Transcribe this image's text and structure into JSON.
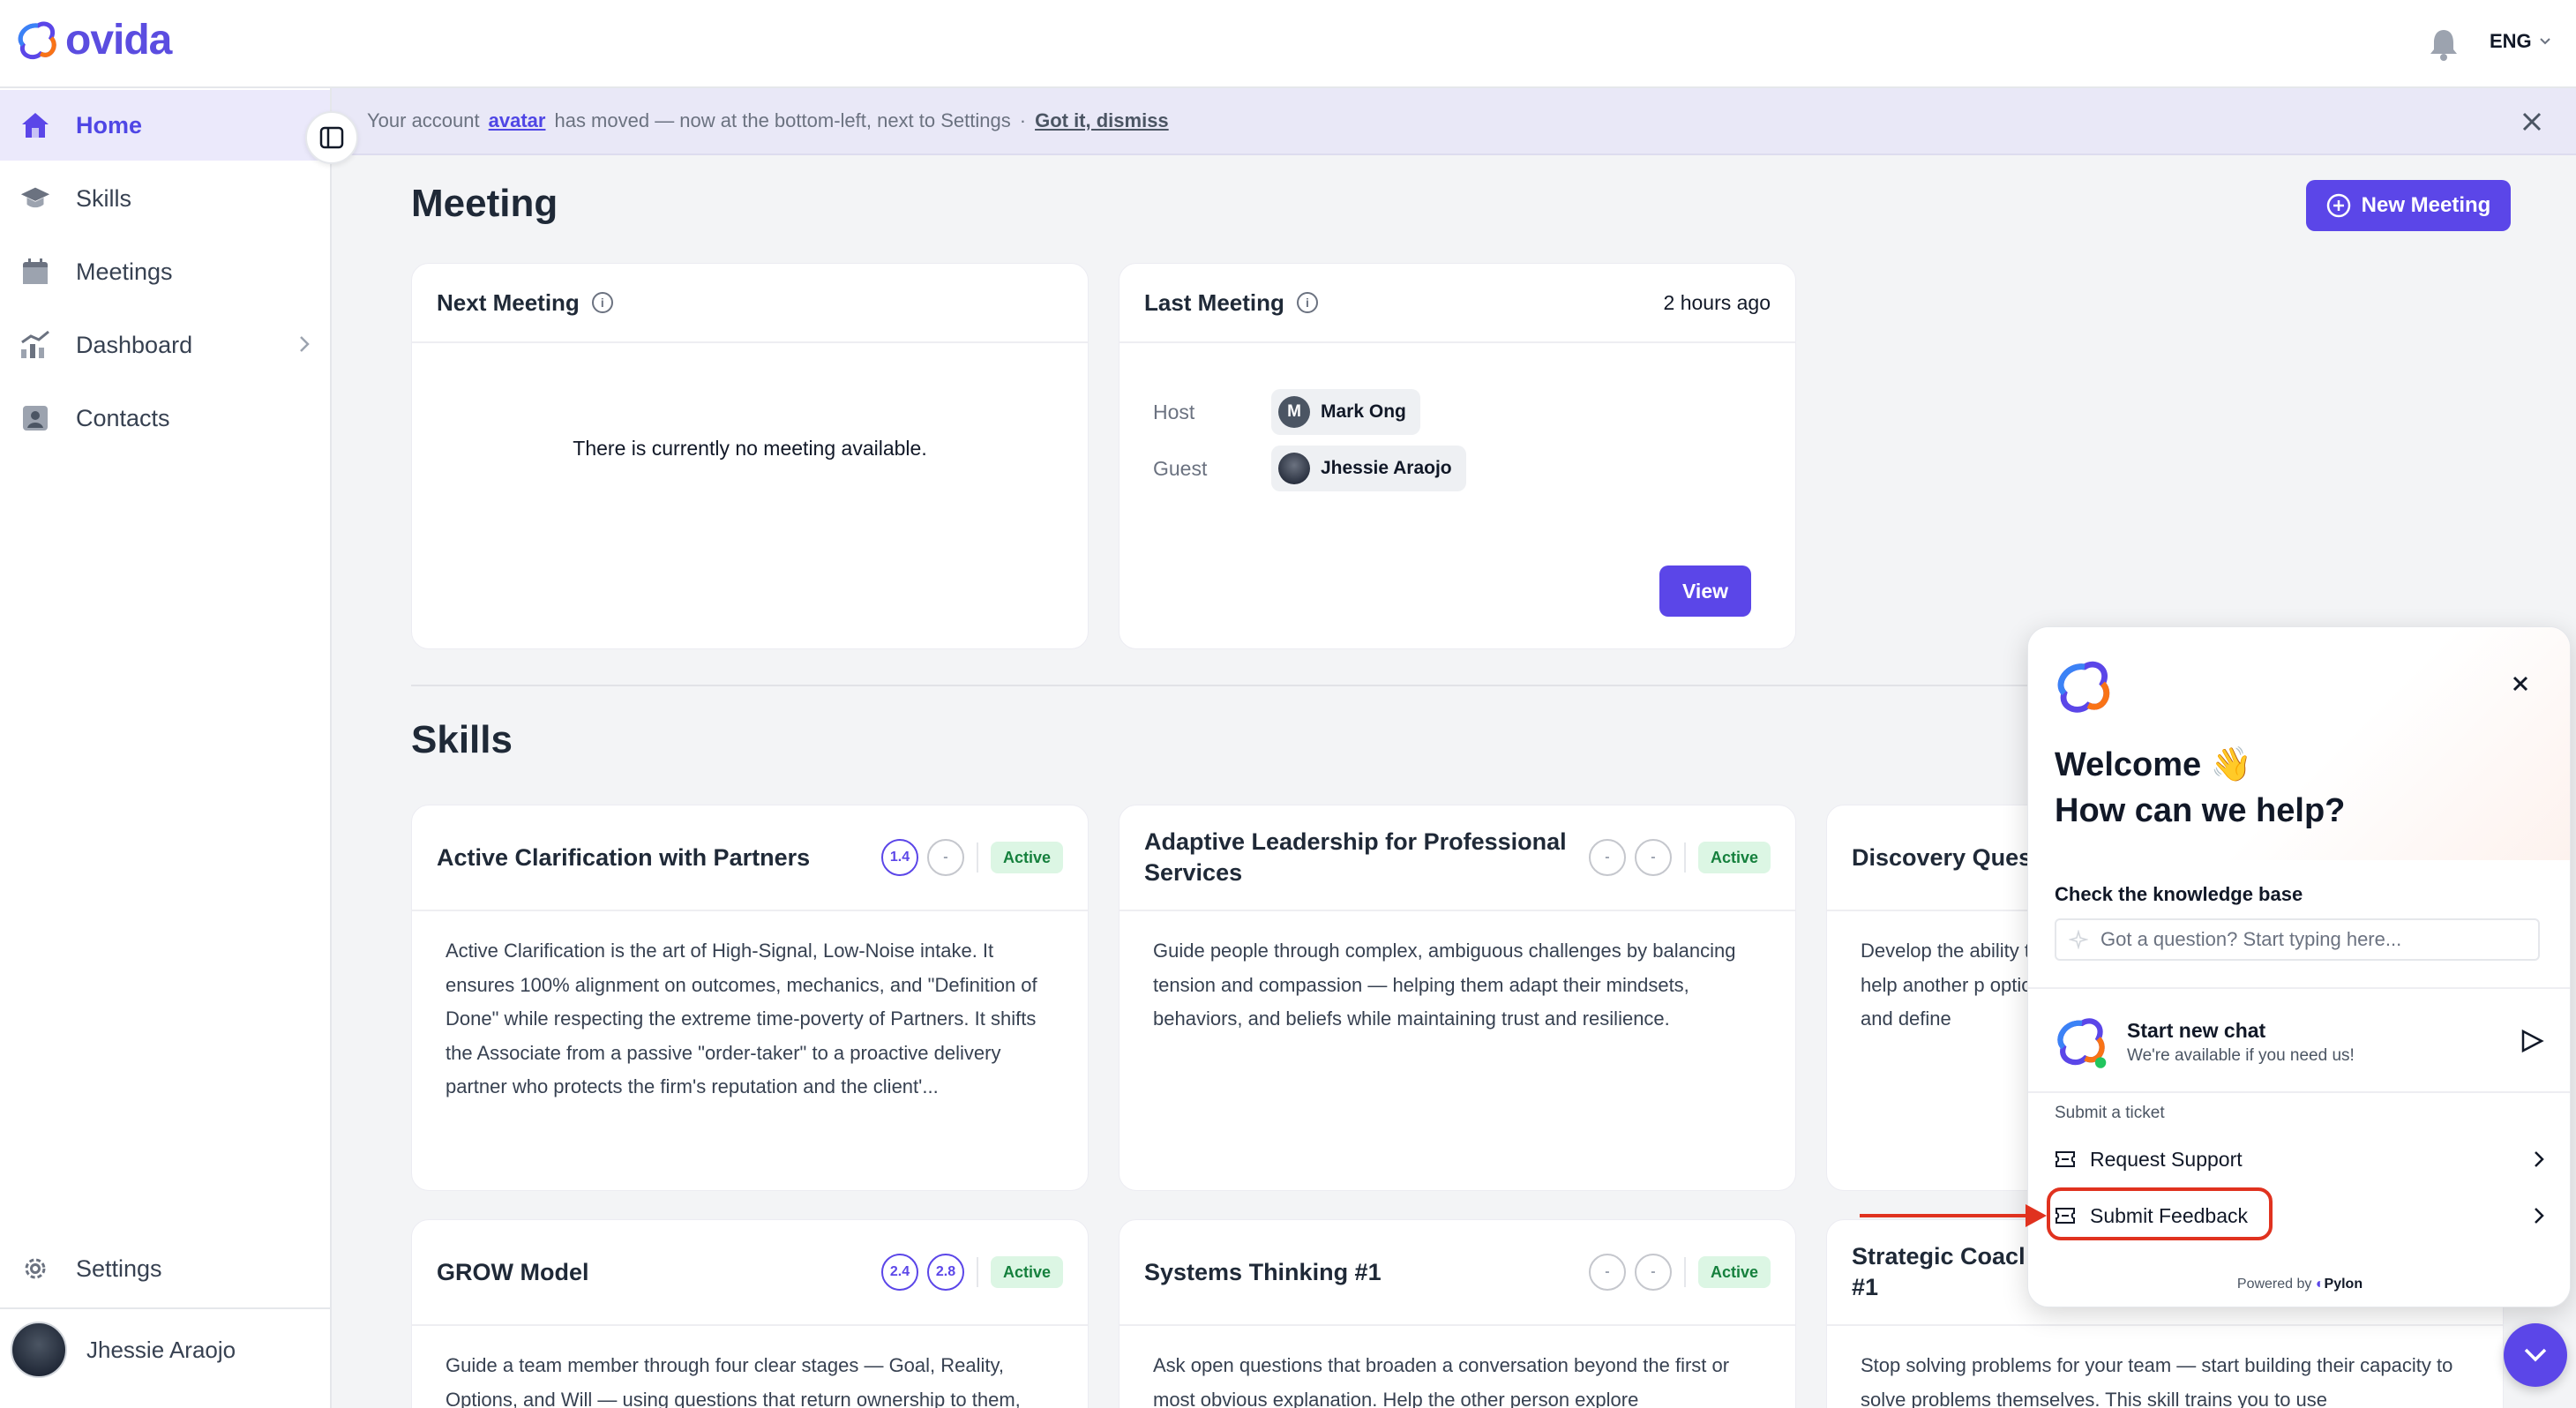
{
  "brand": {
    "name": "ovida",
    "accent": "#5b46e8"
  },
  "header": {
    "language": "ENG"
  },
  "sidebar": {
    "items": [
      {
        "label": "Home",
        "icon": "home-icon",
        "active": true
      },
      {
        "label": "Skills",
        "icon": "graduation-cap-icon"
      },
      {
        "label": "Meetings",
        "icon": "calendar-icon"
      },
      {
        "label": "Dashboard",
        "icon": "chart-icon",
        "has_submenu": true
      },
      {
        "label": "Contacts",
        "icon": "contact-card-icon"
      }
    ],
    "settings_label": "Settings",
    "user_name": "Jhessie Araojo"
  },
  "banner": {
    "prefix": "Your account",
    "link": "avatar",
    "message": "has moved — now at the bottom-left, next to Settings",
    "separator": "·",
    "dismiss": "Got it, dismiss"
  },
  "meeting": {
    "title": "Meeting",
    "new_button": "New Meeting",
    "next": {
      "title": "Next Meeting",
      "empty": "There is currently no meeting available."
    },
    "last": {
      "title": "Last Meeting",
      "time": "2 hours ago",
      "host_label": "Host",
      "host_name": "Mark Ong",
      "host_initial": "M",
      "guest_label": "Guest",
      "guest_name": "Jhessie Araojo",
      "view_button": "View"
    }
  },
  "skills": {
    "title": "Skills",
    "cards": [
      {
        "name": "Active Clarification with Partners",
        "score1": "1.4",
        "score2": "-",
        "status": "Active",
        "description": "Active Clarification is the art of High-Signal, Low-Noise intake. It ensures 100% alignment on outcomes, mechanics, and \"Definition of Done\" while respecting the extreme time-poverty of Partners. It shifts the Associate from a passive \"order-taker\" to a proactive delivery partner who protects the firm's reputation and the client'..."
      },
      {
        "name": "Adaptive Leadership for Professional Services",
        "score1": "-",
        "score2": "-",
        "status": "Active",
        "description": "Guide people through complex, ambiguous challenges by balancing tension and compassion — helping them adapt their mindsets, behaviors, and beliefs while maintaining trust and resilience."
      },
      {
        "name": "Discovery Ques",
        "description": "Develop the ability that help another p options, and define"
      },
      {
        "name": "GROW Model",
        "score1": "2.4",
        "score2": "2.8",
        "status": "Active",
        "description": "Guide a team member through four clear stages — Goal, Reality, Options, and Will — using questions that return ownership to them,"
      },
      {
        "name": "Systems Thinking #1",
        "score1": "-",
        "score2": "-",
        "status": "Active",
        "description": "Ask open questions that broaden a conversation beyond the first or most obvious explanation. Help the other person explore"
      },
      {
        "name": "Strategic Coacl #1",
        "description": "Stop solving problems for your team — start building their capacity to solve problems themselves. This skill trains you to use"
      }
    ]
  },
  "help_widget": {
    "welcome_line1": "Welcome 👋",
    "welcome_line2": "How can we help?",
    "kb_label": "Check the knowledge base",
    "kb_placeholder": "Got a question? Start typing here...",
    "chat_title": "Start new chat",
    "chat_sub": "We're available if you need us!",
    "ticket_label": "Submit a ticket",
    "request_support": "Request Support",
    "submit_feedback": "Submit Feedback",
    "powered_prefix": "Powered by",
    "powered_brand": "Pylon"
  }
}
